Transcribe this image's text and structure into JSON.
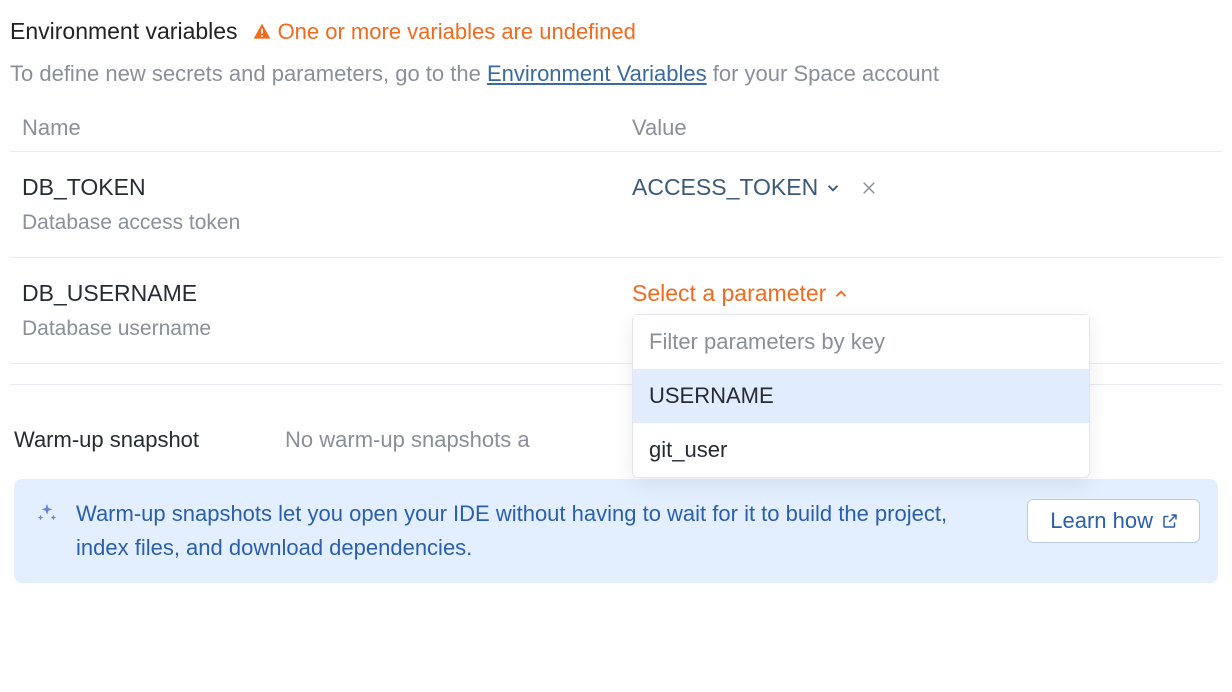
{
  "section": {
    "title": "Environment variables",
    "warning": "One or more variables are undefined",
    "help_pre": "To define new secrets and parameters, go to the ",
    "help_link": "Environment Variables",
    "help_post": " for your Space account"
  },
  "columns": {
    "name": "Name",
    "value": "Value"
  },
  "rows": [
    {
      "name": "DB_TOKEN",
      "desc": "Database access token",
      "value": "ACCESS_TOKEN"
    },
    {
      "name": "DB_USERNAME",
      "desc": "Database username",
      "value_placeholder": "Select a parameter"
    }
  ],
  "dropdown": {
    "filter_placeholder": "Filter parameters by key",
    "options": [
      "USERNAME",
      "git_user"
    ]
  },
  "warmup": {
    "title": "Warm-up snapshot",
    "empty": "No warm-up snapshots a",
    "callout": "Warm-up snapshots let you open your IDE without having to wait for it to build the project, index files, and download dependencies.",
    "learn_btn": "Learn how"
  }
}
